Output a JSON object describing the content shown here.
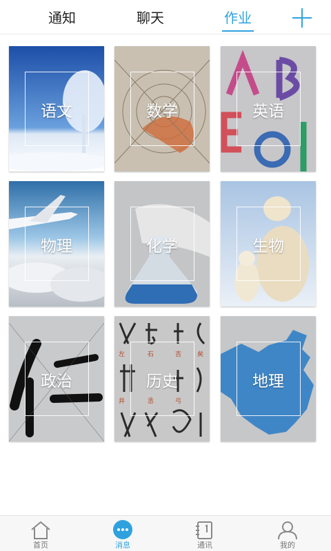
{
  "tabs": [
    {
      "label": "通知"
    },
    {
      "label": "聊天"
    },
    {
      "label": "作业",
      "active": true
    }
  ],
  "header": {
    "add_icon": "plus-icon"
  },
  "subjects": [
    {
      "label": "语文",
      "image": "snowy-tree"
    },
    {
      "label": "数学",
      "image": "golden-spiral-drawing"
    },
    {
      "label": "英语",
      "image": "colorful-letters"
    },
    {
      "label": "物理",
      "image": "airplane-clouds"
    },
    {
      "label": "化学",
      "image": "flask-blue-liquid"
    },
    {
      "label": "生物",
      "image": "polar-bears"
    },
    {
      "label": "政治",
      "image": "calligraphy-ren"
    },
    {
      "label": "历史",
      "image": "ancient-characters"
    },
    {
      "label": "地理",
      "image": "china-map"
    }
  ],
  "bottom_nav": [
    {
      "label": "首页",
      "icon": "home-icon"
    },
    {
      "label": "消息",
      "icon": "message-icon",
      "active": true
    },
    {
      "label": "通讯",
      "icon": "contacts-icon"
    },
    {
      "label": "我的",
      "icon": "profile-icon"
    }
  ],
  "colors": {
    "accent": "#2fa2de"
  }
}
